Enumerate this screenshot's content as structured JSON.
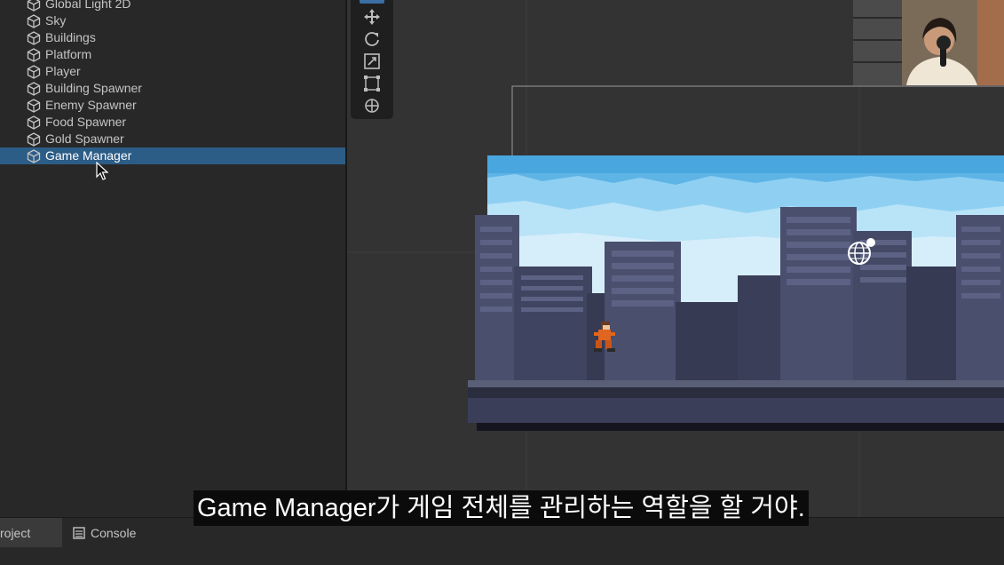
{
  "hierarchy": {
    "items": [
      {
        "label": "Global Light 2D",
        "selected": false
      },
      {
        "label": "Sky",
        "selected": false
      },
      {
        "label": "Buildings",
        "selected": false
      },
      {
        "label": "Platform",
        "selected": false
      },
      {
        "label": "Player",
        "selected": false
      },
      {
        "label": "Building Spawner",
        "selected": false
      },
      {
        "label": "Enemy Spawner",
        "selected": false
      },
      {
        "label": "Food Spawner",
        "selected": false
      },
      {
        "label": "Gold Spawner",
        "selected": false
      },
      {
        "label": "Game Manager",
        "selected": true
      }
    ]
  },
  "scene_tools": [
    "move-tool-icon",
    "rotate-tool-icon",
    "scale-tool-icon",
    "rect-tool-icon",
    "transform-tool-icon"
  ],
  "bottom_tabs": {
    "project_label": "roject",
    "console_label": "Console"
  },
  "subtitle": "Game Manager가 게임 전체를 관리하는 역할을 할 거야.",
  "colors": {
    "selection": "#2c5d87",
    "panel_bg": "#282828",
    "scene_bg": "#333333",
    "sky": "#5fb4e6",
    "building": "#4a4f6d"
  }
}
